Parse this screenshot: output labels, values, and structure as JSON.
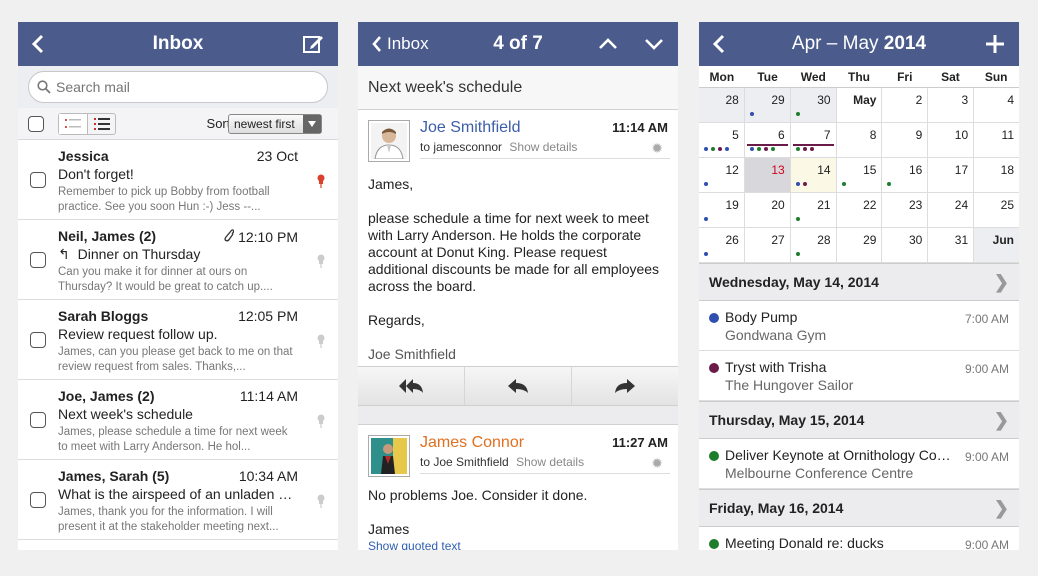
{
  "inbox": {
    "title": "Inbox",
    "search_placeholder": "Search mail",
    "sort_label": "Sort:",
    "sort_value": "newest first",
    "messages": [
      {
        "from": "Jessica",
        "time": "23 Oct",
        "subject": "Don't forget!",
        "preview": "Remember to pick up Bobby from football practice. See you soon Hun :-) Jess --...",
        "flagged": true
      },
      {
        "from": "Neil, James  (2)",
        "time": "12:10 PM",
        "subject": "Dinner on Thursday",
        "preview": "Can you make it for dinner at ours on Thursday? It would be great to catch up....",
        "flagged": false
      },
      {
        "from": "Sarah Bloggs",
        "time": "12:05 PM",
        "subject": "Review request follow up.",
        "preview": "James, can you please get back to me on that review request from sales. Thanks,...",
        "flagged": false
      },
      {
        "from": "Joe, James  (2)",
        "time": "11:14 AM",
        "subject": "Next week's schedule",
        "preview": "James, please schedule a time for next week to meet with Larry Anderson. He hol...",
        "flagged": false
      },
      {
        "from": "James, Sarah  (5)",
        "time": "10:34 AM",
        "subject": "What is the airspeed of an unladen swallow?",
        "preview": "James, thank you for the information. I will present it at the stakeholder meeting next...",
        "flagged": false
      }
    ]
  },
  "message": {
    "back_label": "Inbox",
    "position": "4 of 7",
    "subject": "Next week's schedule",
    "first": {
      "from": "Joe Smithfield",
      "to": "to jamesconnor",
      "show_details": "Show details",
      "time": "11:14 AM",
      "greeting": "James,",
      "body": "please schedule a time for next week to meet with Larry Anderson. He holds the corporate account at Donut King. Please request additional discounts be made for all employees across the board.",
      "closing": "Regards,",
      "signature": "Joe Smithfield"
    },
    "second": {
      "from": "James Connor",
      "to": "to Joe Smithfield",
      "show_details": "Show details",
      "time": "11:27 AM",
      "body": "No problems Joe. Consider it done.",
      "signature": "James",
      "quoted_link": "Show quoted text"
    }
  },
  "calendar": {
    "title": "Apr – May ",
    "title_year": "2014",
    "weekdays": [
      "Mon",
      "Tue",
      "Wed",
      "Thu",
      "Fri",
      "Sat",
      "Sun"
    ],
    "rows": [
      [
        "28",
        "29",
        "30",
        "May",
        "2",
        "3",
        "4"
      ],
      [
        "5",
        "6",
        "7",
        "8",
        "9",
        "10",
        "11"
      ],
      [
        "12",
        "13",
        "14",
        "15",
        "16",
        "17",
        "18"
      ],
      [
        "19",
        "20",
        "21",
        "22",
        "23",
        "24",
        "25"
      ],
      [
        "26",
        "27",
        "28",
        "29",
        "30",
        "31",
        "Jun"
      ]
    ],
    "days": [
      {
        "header": "Wednesday, May 14, 2014",
        "events": [
          {
            "title": "Body Pump",
            "location": "Gondwana Gym",
            "time": "7:00 AM",
            "color": "#2f4fb0"
          },
          {
            "title": "Tryst with Trisha",
            "location": "The Hungover Sailor",
            "time": "9:00 AM",
            "color": "#6b1b4a"
          }
        ]
      },
      {
        "header": "Thursday, May 15, 2014",
        "events": [
          {
            "title": "Deliver Keynote at Ornithology Conference",
            "location": "Melbourne Conference Centre",
            "time": "9:00 AM",
            "color": "#1e7d2c"
          }
        ]
      },
      {
        "header": "Friday, May 16, 2014",
        "events": [
          {
            "title": "Meeting Donald re: ducks",
            "location": "",
            "time": "9:00 AM",
            "color": "#1e7d2c"
          }
        ]
      }
    ],
    "colors": {
      "blue": "#2f4fb0",
      "purple": "#6b1b4a",
      "green": "#1e7d2c",
      "navbar": "#4a5b8c"
    }
  }
}
